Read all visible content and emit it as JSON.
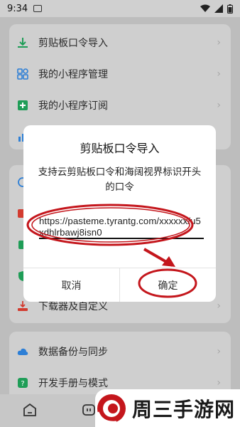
{
  "status_bar": {
    "time": "9:34"
  },
  "menu": {
    "items": [
      {
        "label": "剪贴板口令导入",
        "icon": "download-icon"
      },
      {
        "label": "我的小程序管理",
        "icon": "grid-icon"
      },
      {
        "label": "我的小程序订阅",
        "icon": "plus-document-icon"
      },
      {
        "label": "下载器及自定义",
        "icon": "download-tray-icon"
      },
      {
        "label": "数据备份与同步",
        "icon": "cloud-icon"
      },
      {
        "label": "开发手册与模式",
        "icon": "help-icon"
      }
    ]
  },
  "dialog": {
    "title": "剪贴板口令导入",
    "message": "支持云剪贴板口令和海阔视界标识开头的口令",
    "input_value": "https://pasteme.tyrantg.com/xxxxxx/u5xdhlrbawj8isn0",
    "cancel_label": "取消",
    "confirm_label": "确定"
  },
  "watermark": {
    "text": "周三手游网"
  },
  "colors": {
    "highlight": "#c4161c",
    "accent_green": "#1f9d57"
  }
}
